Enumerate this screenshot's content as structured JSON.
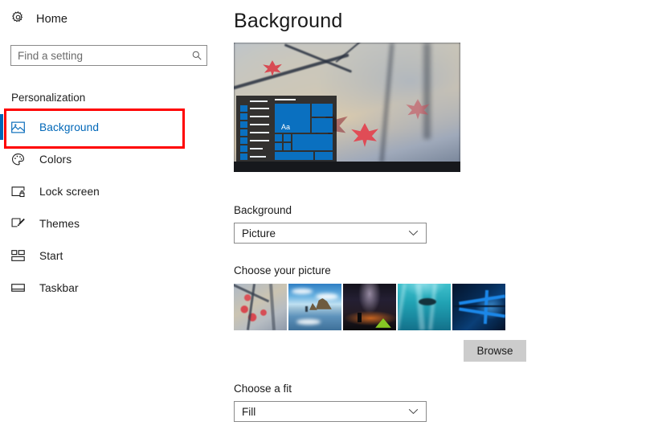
{
  "sidebar": {
    "home": {
      "label": "Home",
      "icon": "gear-icon"
    },
    "search": {
      "placeholder": "Find a setting",
      "value": "",
      "icon": "search-icon"
    },
    "section_title": "Personalization",
    "items": [
      {
        "label": "Background",
        "icon": "picture-icon",
        "selected": true
      },
      {
        "label": "Colors",
        "icon": "palette-icon",
        "selected": false
      },
      {
        "label": "Lock screen",
        "icon": "lock-screen-icon",
        "selected": false
      },
      {
        "label": "Themes",
        "icon": "themes-brush-icon",
        "selected": false
      },
      {
        "label": "Start",
        "icon": "start-tiles-icon",
        "selected": false
      },
      {
        "label": "Taskbar",
        "icon": "taskbar-icon",
        "selected": false
      }
    ],
    "highlight_color": "#ff0000",
    "accent_color": "#0067b8"
  },
  "main": {
    "title": "Background",
    "preview": {
      "tile_text": "Aa",
      "tile_color": "#0a70c0"
    },
    "background_label": "Background",
    "background_value": "Picture",
    "choose_picture_label": "Choose your picture",
    "thumbnails": [
      {
        "name": "autumn-leaves"
      },
      {
        "name": "beach-rock"
      },
      {
        "name": "milky-way-camp"
      },
      {
        "name": "underwater"
      },
      {
        "name": "windows-hero"
      }
    ],
    "browse_label": "Browse",
    "fit_label": "Choose a fit",
    "fit_value": "Fill"
  }
}
